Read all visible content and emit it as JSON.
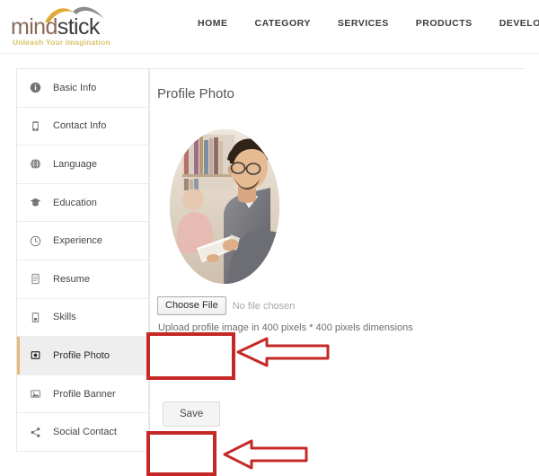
{
  "brand": {
    "name_part1": "mind",
    "name_part2": "stick",
    "tagline": "Unleash Your Imagination",
    "logo_gold": "#e0a93a",
    "logo_gray": "#8c8c8c",
    "tagline_color": "#d8c46a"
  },
  "nav": {
    "items": [
      {
        "label": "HOME"
      },
      {
        "label": "CATEGORY"
      },
      {
        "label": "SERVICES"
      },
      {
        "label": "PRODUCTS"
      },
      {
        "label": "DEVELOPER SECTION"
      }
    ]
  },
  "sidebar": {
    "items": [
      {
        "label": "Basic Info",
        "icon": "info-circle-icon",
        "active": false
      },
      {
        "label": "Contact Info",
        "icon": "phone-icon",
        "active": false
      },
      {
        "label": "Language",
        "icon": "globe-icon",
        "active": false
      },
      {
        "label": "Education",
        "icon": "graduation-cap-icon",
        "active": false
      },
      {
        "label": "Experience",
        "icon": "clock-icon",
        "active": false
      },
      {
        "label": "Resume",
        "icon": "document-icon",
        "active": false
      },
      {
        "label": "Skills",
        "icon": "skills-icon",
        "active": false
      },
      {
        "label": "Profile Photo",
        "icon": "photo-icon",
        "active": true
      },
      {
        "label": "Profile Banner",
        "icon": "image-icon",
        "active": false
      },
      {
        "label": "Social Contact",
        "icon": "share-icon",
        "active": false
      }
    ],
    "active_accent": "#e8b97a",
    "active_background": "#eeeeee"
  },
  "main": {
    "title": "Profile Photo",
    "avatar_alt": "Man wearing glasses reading a book in a library",
    "upload": {
      "choose_file_label": "Choose File",
      "no_file_text": "No file chosen",
      "hint": "Upload profile image in 400 pixels * 400 pixels dimensions"
    },
    "save_label": "Save"
  },
  "annotations": {
    "color": "#c62828",
    "boxes": [
      {
        "name": "upload-highlight",
        "target": "Choose File"
      },
      {
        "name": "save-highlight",
        "target": "Save"
      }
    ],
    "arrows": [
      {
        "name": "upload-arrow",
        "direction": "left"
      },
      {
        "name": "save-arrow",
        "direction": "left"
      }
    ]
  }
}
